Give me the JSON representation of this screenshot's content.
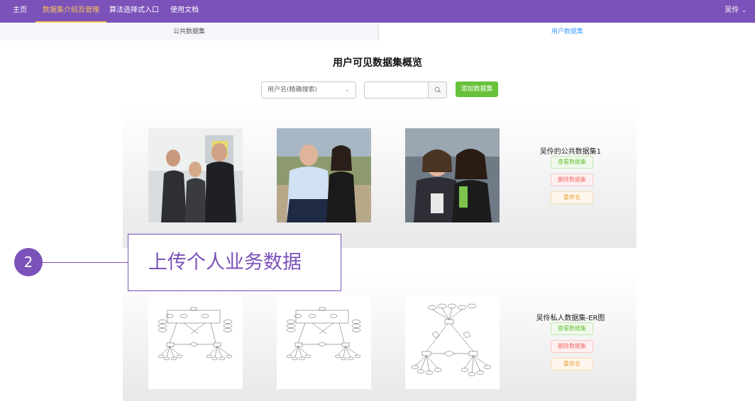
{
  "nav": {
    "items": [
      "主页",
      "数据集介绍及管理",
      "算法选择式入口",
      "使用文档"
    ],
    "user": "吴伶",
    "colors": {
      "bar": "#7b52b9",
      "active": "#f5c15c"
    }
  },
  "tabs": [
    "公共数据集",
    "用户数据集"
  ],
  "page_title": "用户可见数据集概览",
  "search": {
    "select_placeholder": "用户名(精确搜索)",
    "input_value": "",
    "add_button": "添加数据集"
  },
  "datasets": [
    {
      "name": "吴伶的公共数据集1",
      "thumb_icons": [
        "photo-people-1",
        "photo-people-2",
        "photo-people-3"
      ],
      "buttons": {
        "view": "查看数据集",
        "delete": "删除数据集",
        "rename": "重命名"
      }
    },
    {
      "name": "吴伶私人数据集-ER图",
      "thumb_icons": [
        "er-diagram-1",
        "er-diagram-2",
        "er-diagram-3"
      ],
      "buttons": {
        "view": "查看数据集",
        "delete": "删除数据集",
        "rename": "重命名"
      }
    }
  ],
  "callout": {
    "number": "2",
    "text": "上传个人业务数据",
    "color": "#7b52b9"
  }
}
